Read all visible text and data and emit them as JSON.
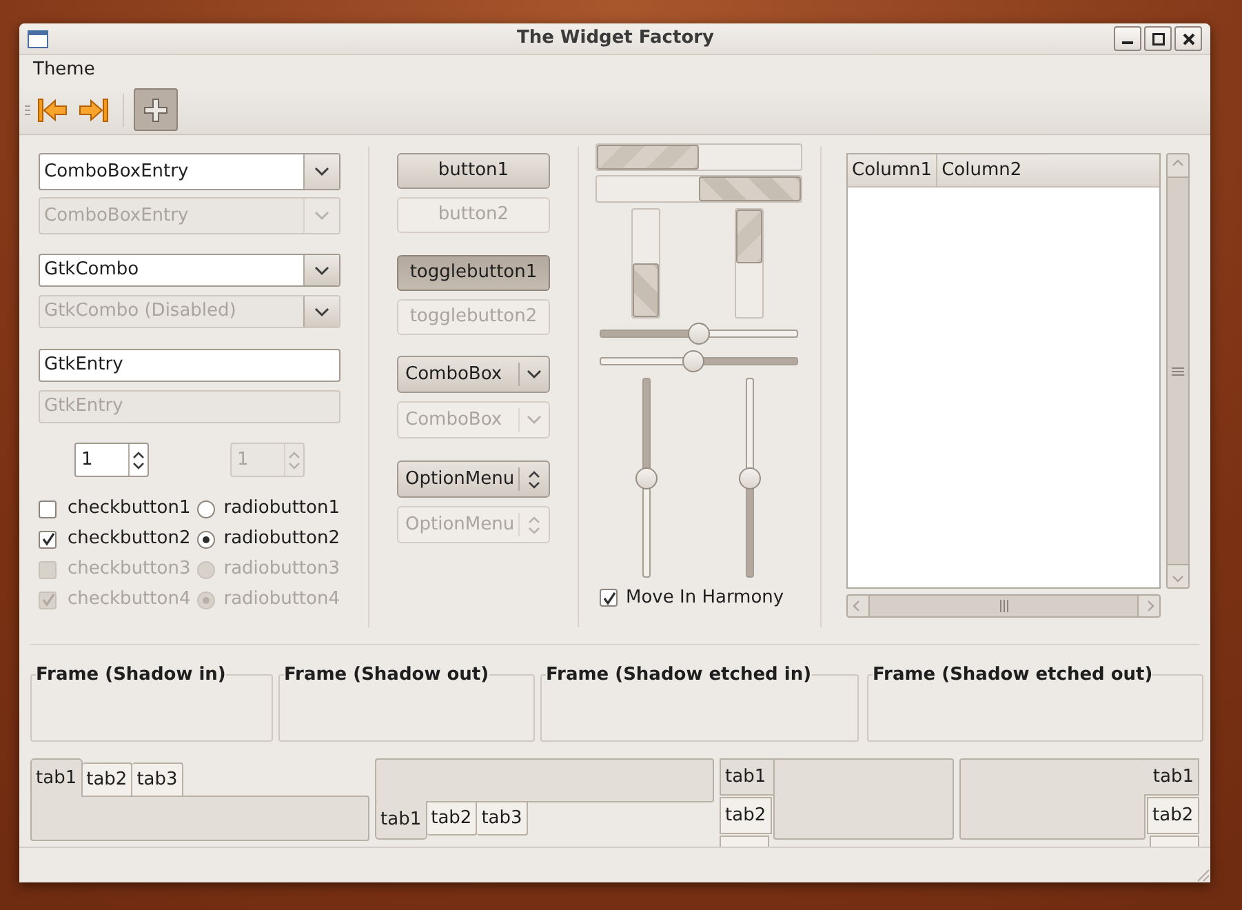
{
  "window": {
    "title": "The Widget Factory"
  },
  "menu": [
    {
      "label": "Theme"
    }
  ],
  "toolbar": [
    {
      "kind": "first",
      "selected": false
    },
    {
      "kind": "last",
      "selected": false
    },
    {
      "kind": "add",
      "selected": true
    }
  ],
  "combo_entries": [
    {
      "value": "ComboBoxEntry",
      "disabled": false
    },
    {
      "value": "ComboBoxEntry",
      "disabled": true
    }
  ],
  "gtk_combos": [
    {
      "value": "GtkCombo",
      "disabled": false
    },
    {
      "value": "GtkCombo (Disabled)",
      "disabled": true
    }
  ],
  "entries": [
    {
      "value": "GtkEntry",
      "disabled": false
    },
    {
      "value": "GtkEntry",
      "disabled": true
    }
  ],
  "spin_buttons": [
    {
      "value": "1",
      "disabled": false
    },
    {
      "value": "1",
      "disabled": true
    }
  ],
  "check_buttons": [
    {
      "label": "checkbutton1",
      "checked": false,
      "disabled": false
    },
    {
      "label": "checkbutton2",
      "checked": true,
      "disabled": false
    },
    {
      "label": "checkbutton3",
      "checked": false,
      "disabled": true
    },
    {
      "label": "checkbutton4",
      "checked": true,
      "disabled": true
    }
  ],
  "radio_buttons": [
    {
      "label": "radiobutton1",
      "selected": false,
      "disabled": false
    },
    {
      "label": "radiobutton2",
      "selected": true,
      "disabled": false
    },
    {
      "label": "radiobutton3",
      "selected": false,
      "disabled": true
    },
    {
      "label": "radiobutton4",
      "selected": true,
      "disabled": true
    }
  ],
  "buttons": [
    {
      "label": "button1",
      "disabled": false
    },
    {
      "label": "button2",
      "disabled": true
    }
  ],
  "toggle_buttons": [
    {
      "label": "togglebutton1",
      "on": true,
      "disabled": false
    },
    {
      "label": "togglebutton2",
      "on": false,
      "disabled": true
    }
  ],
  "combo_boxes": [
    {
      "value": "ComboBox",
      "disabled": false
    },
    {
      "value": "ComboBox",
      "disabled": true
    }
  ],
  "option_menus": [
    {
      "value": "OptionMenu",
      "disabled": false
    },
    {
      "value": "OptionMenu",
      "disabled": true
    }
  ],
  "progress_bars": [
    {
      "level": 0.5,
      "inverted": false
    },
    {
      "level": 0.5,
      "inverted": true
    }
  ],
  "vertical_progress_bars": [
    {
      "level": 0.5,
      "inverted": true
    },
    {
      "level": 0.5,
      "inverted": false
    }
  ],
  "sliders": [
    {
      "level": 0.5,
      "inverted": false
    },
    {
      "level": 0.47,
      "inverted": true
    }
  ],
  "vertical_sliders": [
    {
      "level": 0.5,
      "inverted": false
    },
    {
      "level": 0.5,
      "inverted": true
    }
  ],
  "move_in_harmony": {
    "label": "Move In Harmony",
    "checked": true
  },
  "tree": {
    "columns": [
      "Column1",
      "Column2"
    ]
  },
  "frames": [
    {
      "label": "Frame (Shadow in)"
    },
    {
      "label": "Frame (Shadow out)"
    },
    {
      "label": "Frame (Shadow etched in)"
    },
    {
      "label": "Frame (Shadow etched out)"
    }
  ],
  "notebooks": [
    {
      "kind": "top",
      "tabs": [
        {
          "label": "tab1",
          "selected": true
        },
        {
          "label": "tab2",
          "selected": false
        },
        {
          "label": "tab3",
          "selected": false
        }
      ]
    },
    {
      "kind": "bottom",
      "tabs": [
        {
          "label": "tab1",
          "selected": true
        },
        {
          "label": "tab2",
          "selected": false
        },
        {
          "label": "tab3",
          "selected": false
        }
      ]
    },
    {
      "kind": "left",
      "tabs": [
        {
          "label": "tab1",
          "selected": true
        },
        {
          "label": "tab2",
          "selected": false
        }
      ]
    },
    {
      "kind": "right",
      "tabs": [
        {
          "label": "tab1",
          "selected": true
        },
        {
          "label": "tab2",
          "selected": false
        }
      ]
    }
  ]
}
